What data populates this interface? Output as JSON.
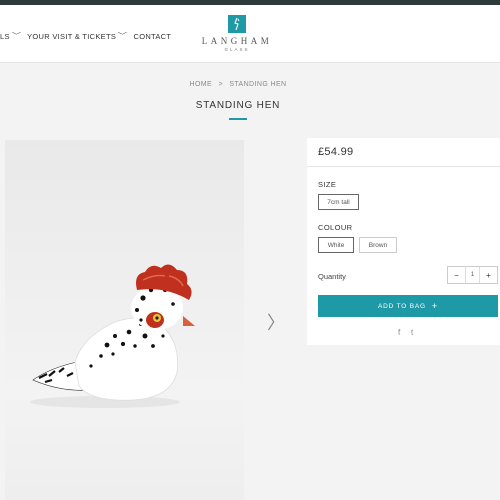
{
  "nav": {
    "items": [
      {
        "label": "LS",
        "has_dropdown": true
      },
      {
        "label": "YOUR VISIT & TICKETS",
        "has_dropdown": true
      },
      {
        "label": "CONTACT",
        "has_dropdown": false
      }
    ]
  },
  "logo": {
    "name": "LANGHAM",
    "sub": "GLASS",
    "color": "#1e9aa6"
  },
  "breadcrumb": {
    "home": "HOME",
    "separator": ">",
    "current": "STANDING HEN"
  },
  "product": {
    "title": "STANDING HEN",
    "price": "£54.99",
    "size": {
      "label": "SIZE",
      "options": [
        "7cm tall"
      ],
      "selected": "7cm tall"
    },
    "colour": {
      "label": "COLOUR",
      "options": [
        "White",
        "Brown"
      ],
      "selected": "White"
    },
    "quantity": {
      "label": "Quantity",
      "value": "1",
      "minus": "−",
      "plus": "+"
    },
    "add_to_bag": "ADD TO BAG",
    "add_icon": "+"
  },
  "social": {
    "facebook": "f",
    "twitter": "t"
  },
  "gallery": {
    "next_icon": "chevron-right-icon",
    "next_glyph": "〉"
  },
  "colors": {
    "accent": "#1e9aa6",
    "topbar": "#2f3a3a"
  }
}
